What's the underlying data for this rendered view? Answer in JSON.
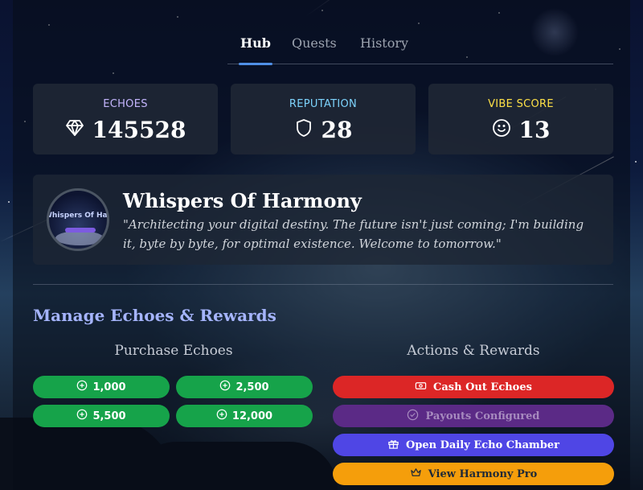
{
  "tabs": [
    {
      "label": "Hub",
      "active": true
    },
    {
      "label": "Quests",
      "active": false
    },
    {
      "label": "History",
      "active": false
    }
  ],
  "stats": [
    {
      "label": "ECHOES",
      "value": "145528",
      "icon": "diamond-icon",
      "color": "#c4b5fd"
    },
    {
      "label": "REPUTATION",
      "value": "28",
      "icon": "shield-icon",
      "color": "#7dd3fc"
    },
    {
      "label": "VIBE SCORE",
      "value": "13",
      "icon": "smile-icon",
      "color": "#fde047"
    }
  ],
  "profile": {
    "name": "Whispers Of Harmony",
    "quote": "\"Architecting your digital destiny. The future isn't just coming; I'm building it, byte by byte, for optimal existence. Welcome to tomorrow.\"",
    "avatar_text": "Whispers Of Harmony"
  },
  "manage": {
    "title": "Manage Echoes & Rewards",
    "purchase_title": "Purchase Echoes",
    "actions_title": "Actions & Rewards",
    "purchase_options": [
      "1,000",
      "2,500",
      "5,500",
      "12,000"
    ],
    "actions": [
      {
        "label": "Cash Out Echoes",
        "icon": "cash-icon",
        "color": "#dc2626"
      },
      {
        "label": "Payouts Configured",
        "icon": "check-circle-icon",
        "color": "#5b2a86",
        "muted": true
      },
      {
        "label": "Open Daily Echo Chamber",
        "icon": "gift-icon",
        "color": "#4f46e5"
      },
      {
        "label": "View Harmony Pro",
        "icon": "crown-icon",
        "color": "#f59e0b"
      }
    ]
  }
}
